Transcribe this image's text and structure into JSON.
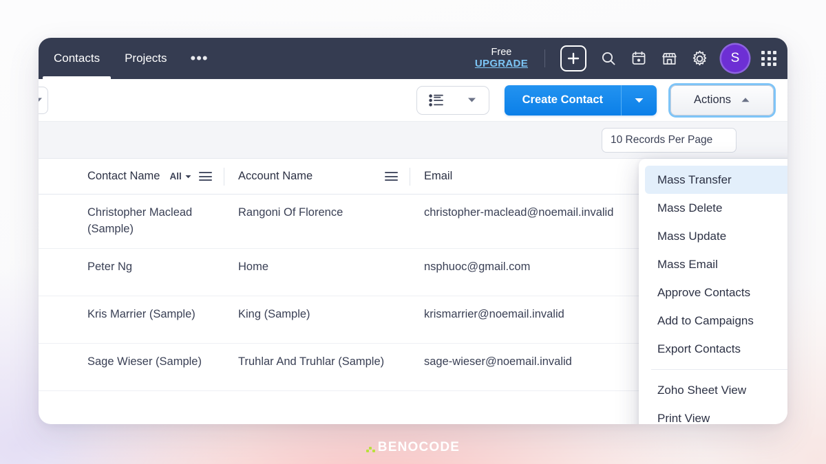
{
  "nav": {
    "tabs": [
      {
        "label": "Contacts",
        "active": true
      },
      {
        "label": "Projects",
        "active": false
      }
    ],
    "more_label": "•••",
    "plan_label": "Free",
    "upgrade_label": "UPGRADE",
    "avatar_initial": "S",
    "icons": [
      "plus-icon",
      "search-icon",
      "calendar-icon",
      "marketplace-icon",
      "gear-icon",
      "apps-grid-icon"
    ]
  },
  "toolbar": {
    "view_select_icon": "list-view-icon",
    "create_contact_label": "Create Contact",
    "actions_label": "Actions",
    "records_per_page": "10 Records Per Page"
  },
  "actions_menu": {
    "items": [
      {
        "label": "Mass Transfer",
        "highlight": true
      },
      {
        "label": "Mass Delete",
        "highlight": false
      },
      {
        "label": "Mass Update",
        "highlight": false
      },
      {
        "label": "Mass Email",
        "highlight": false
      },
      {
        "label": "Approve Contacts",
        "highlight": false
      },
      {
        "label": "Add to Campaigns",
        "highlight": false
      },
      {
        "label": "Export Contacts",
        "highlight": false
      }
    ],
    "items_after_separator": [
      {
        "label": "Zoho Sheet View",
        "highlight": false
      },
      {
        "label": "Print View",
        "highlight": false
      }
    ]
  },
  "table": {
    "columns": [
      {
        "label": "Contact Name",
        "filter": "All"
      },
      {
        "label": "Account Name",
        "filter": ""
      },
      {
        "label": "Email",
        "filter": ""
      }
    ],
    "rows": [
      {
        "contact_name": "Christopher Maclead (Sample)",
        "account_name": "Rangoni Of Florence",
        "email": "christopher-maclead@noemail.invalid"
      },
      {
        "contact_name": "Peter Ng",
        "account_name": "Home",
        "email": "nsphuoc@gmail.com"
      },
      {
        "contact_name": "Kris Marrier (Sample)",
        "account_name": "King (Sample)",
        "email": "krismarrier@noemail.invalid"
      },
      {
        "contact_name": "Sage Wieser (Sample)",
        "account_name": "Truhlar And Truhlar (Sample)",
        "email": "sage-wieser@noemail.invalid"
      }
    ]
  },
  "watermark": {
    "text": "BENOCODE"
  },
  "colors": {
    "nav_background": "#353c51",
    "primary_button": "#0b7fe8",
    "upgrade_link": "#7cc5f5",
    "avatar": "#6d2fd4",
    "menu_highlight": "#e3effb",
    "focus_ring": "#7ec4f7",
    "watermark_accent": "#b9e03c"
  }
}
